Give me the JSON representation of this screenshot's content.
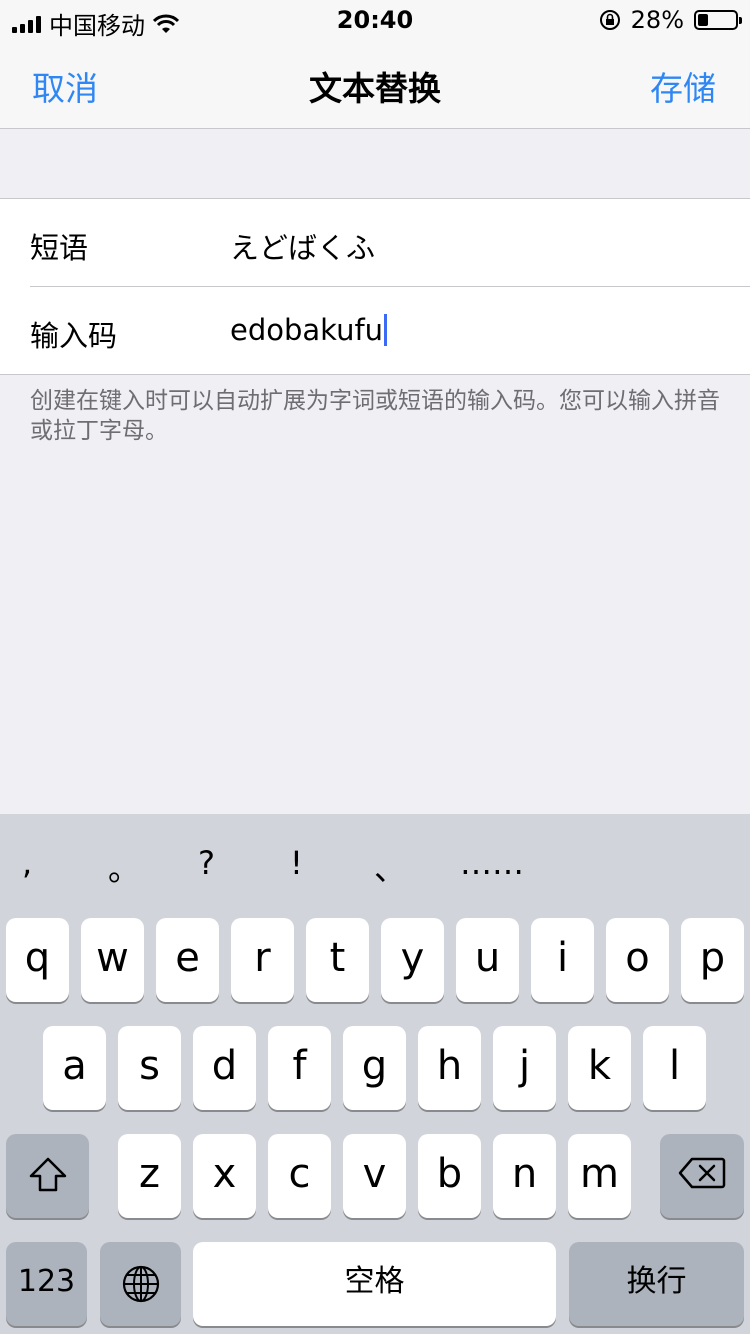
{
  "status": {
    "carrier": "中国移动",
    "time": "20:40",
    "battery": "28%",
    "battery_level": 0.28
  },
  "nav": {
    "cancel": "取消",
    "title": "文本替换",
    "save": "存储"
  },
  "form": {
    "phrase_label": "短语",
    "phrase_value": "えどばくふ",
    "shortcut_label": "输入码",
    "shortcut_value": "edobakufu"
  },
  "help": "创建在键入时可以自动扩展为字词或短语的输入码。您可以输入拼音或拉丁字母。",
  "keyboard": {
    "punct": [
      ",",
      "。",
      "?",
      "!",
      "、",
      "……"
    ],
    "row1": [
      "q",
      "w",
      "e",
      "r",
      "t",
      "y",
      "u",
      "i",
      "o",
      "p"
    ],
    "row2": [
      "a",
      "s",
      "d",
      "f",
      "g",
      "h",
      "j",
      "k",
      "l"
    ],
    "row3": [
      "z",
      "x",
      "c",
      "v",
      "b",
      "n",
      "m"
    ],
    "num_label": "123",
    "space_label": "空格",
    "return_label": "换行"
  },
  "icons": [
    "signal-icon",
    "wifi-icon",
    "rotation-lock-icon",
    "battery-icon",
    "shift-icon",
    "delete-icon",
    "globe-icon"
  ]
}
